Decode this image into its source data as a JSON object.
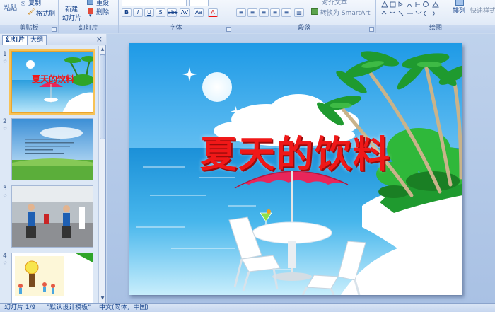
{
  "ribbon": {
    "clipboard": {
      "paste": "粘贴",
      "copy": "复制",
      "format_painter": "格式刷",
      "label": "剪贴板"
    },
    "slides": {
      "new_slide_line1": "新建",
      "new_slide_line2": "幻灯片",
      "reset": "重设",
      "delete": "删除",
      "label": "幻灯片"
    },
    "font": {
      "label": "字体"
    },
    "paragraph": {
      "text_direction": "对齐文本",
      "convert_smartart": "转换为 SmartArt",
      "label": "段落"
    },
    "drawing": {
      "arrange": "排列",
      "quick_styles": "快速样式",
      "label": "绘图"
    }
  },
  "pane": {
    "tabs": [
      "幻灯片",
      "大纲"
    ],
    "close": "×",
    "slides": [
      {
        "number": "1",
        "title": "夏天的饮料"
      },
      {
        "number": "2"
      },
      {
        "number": "3"
      },
      {
        "number": "4"
      }
    ]
  },
  "slide": {
    "title": "夏天的饮料"
  },
  "status": {
    "slide_count": "幻灯片 1/9",
    "theme": "\"默认设计模板\"",
    "language": "中文(简体，中国)"
  },
  "colors": {
    "title_red": "#f01818",
    "ribbon_bg": "#dbe6f5",
    "selection": "#f7c256"
  }
}
